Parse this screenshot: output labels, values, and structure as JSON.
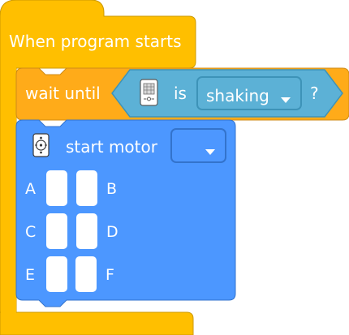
{
  "hat_block": {
    "label": "When program starts",
    "color": "#ffbf00"
  },
  "wait_block": {
    "label": "wait until",
    "color": "#ffab19",
    "condition": {
      "hub_icon": "hub-icon",
      "is_label": "is",
      "gesture_value": "shaking",
      "question_mark": "?",
      "color": "#5cb1d6"
    }
  },
  "motor_block": {
    "motor_icon": "motor-icon",
    "label": "start motor",
    "direction_icon": "clockwise-arrow-icon",
    "color": "#4c97ff",
    "ports": [
      "A",
      "B",
      "C",
      "D",
      "E",
      "F"
    ]
  }
}
